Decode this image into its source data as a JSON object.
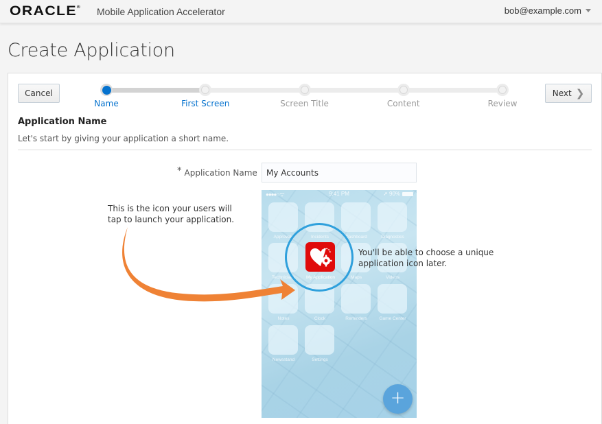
{
  "header": {
    "logo": "ORACLE",
    "logo_mark": "®",
    "app_title": "Mobile Application Accelerator",
    "user": "bob@example.com",
    "user_menu_icon": "caret-down-icon"
  },
  "page": {
    "title": "Create Application"
  },
  "wizard": {
    "cancel_label": "Cancel",
    "next_label": "Next",
    "next_icon": "chevron-right-icon",
    "progress_fraction": 0.25,
    "steps": [
      {
        "label": "Name",
        "state": "active"
      },
      {
        "label": "First Screen",
        "state": "next"
      },
      {
        "label": "Screen Title",
        "state": "pending"
      },
      {
        "label": "Content",
        "state": "pending"
      },
      {
        "label": "Review",
        "state": "pending"
      }
    ]
  },
  "section": {
    "title": "Application Name",
    "description": "Let's start by giving your application a short name."
  },
  "form": {
    "required_marker": "*",
    "app_name_label": "Application Name",
    "app_name_value": "My Accounts"
  },
  "phone_preview": {
    "status": {
      "signal": "●●●●○ ᯤ",
      "time": "9:41 PM",
      "battery": "➚ 90%"
    },
    "apps": [
      [
        "Approvals",
        "Incidents",
        "Dashboard",
        "Diagnostics"
      ],
      [
        "Technicians",
        "My Application",
        "Maps",
        "Videos"
      ],
      [
        "Notes",
        "Clock",
        "Reminders",
        "Game Center"
      ],
      [
        "Newsstand",
        "Settings"
      ]
    ],
    "highlighted_app": "My Application",
    "fab_label": "+"
  },
  "callouts": {
    "left": "This is the icon your users will tap to launch your application.",
    "right": "You'll be able to choose a unique application icon later."
  },
  "colors": {
    "accent": "#0572ce",
    "arrow": "#ef8235",
    "magnifier": "#2fa0dc",
    "app_icon": "#e00a0a",
    "fab": "#5aa4dc"
  }
}
